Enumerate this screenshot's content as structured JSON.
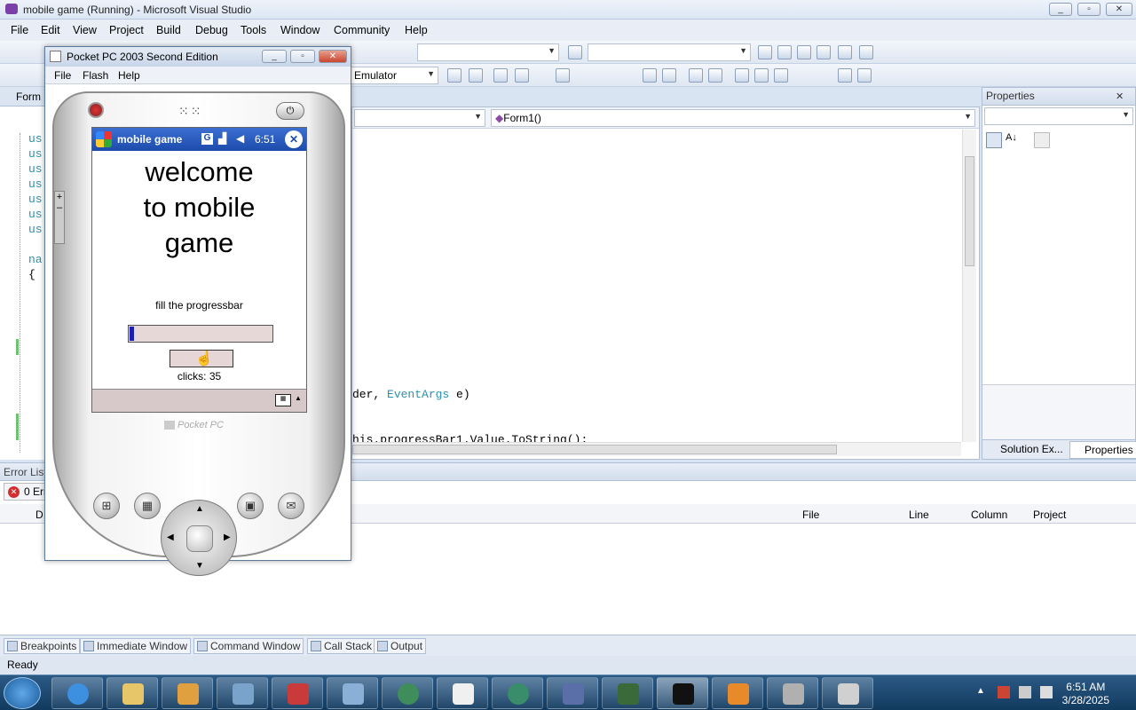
{
  "window": {
    "title": "mobile game (Running) - Microsoft Visual Studio"
  },
  "menu": [
    "File",
    "Edit",
    "View",
    "Project",
    "Build",
    "Debug",
    "Tools",
    "Window",
    "Community",
    "Help"
  ],
  "toolbar": {
    "device_combo": "Emulator"
  },
  "editor": {
    "tab_label": "Form",
    "member_combo": "Form1()",
    "code_lines": [
      {
        "text": "us"
      },
      {
        "text": "us"
      },
      {
        "text": "us"
      },
      {
        "text": "us"
      },
      {
        "text": "us"
      },
      {
        "text": "us"
      },
      {
        "text": "us"
      },
      {
        "text": "na"
      },
      {
        "text": "{"
      }
    ],
    "code_fragment_1_a": "der, ",
    "code_fragment_1_b": "EventArgs",
    "code_fragment_1_c": " e)",
    "code_fragment_2": "his.progressBar1.Value.ToString();"
  },
  "properties": {
    "title": "Properties",
    "tab_solution": "Solution Ex...",
    "tab_properties": "Properties"
  },
  "errorlist": {
    "title": "Error List",
    "errors_button": "0 Err",
    "columns": {
      "desc": "D",
      "file": "File",
      "line": "Line",
      "column": "Column",
      "project": "Project"
    }
  },
  "bottom_tabs": [
    "Breakpoints",
    "Immediate Window",
    "Command Window",
    "Call Stack",
    "Output"
  ],
  "status": "Ready",
  "emulator": {
    "title": "Pocket PC 2003 Second Edition",
    "menu": [
      "File",
      "Flash",
      "Help"
    ],
    "device_logo": "Pocket PC",
    "app_title": "mobile game",
    "time": "6:51",
    "welcome_lines": [
      "welcome",
      "to mobile",
      "game"
    ],
    "instruction": "fill the progressbar",
    "progress_value": 0.03,
    "clicks_text": "clicks: 35"
  },
  "taskbar": {
    "time": "6:51 AM",
    "date": "3/28/2025"
  },
  "colors": {
    "accent": "#1d1db0",
    "ppc_title": "#2a5bc0",
    "taskbar": "#1f4a73"
  }
}
